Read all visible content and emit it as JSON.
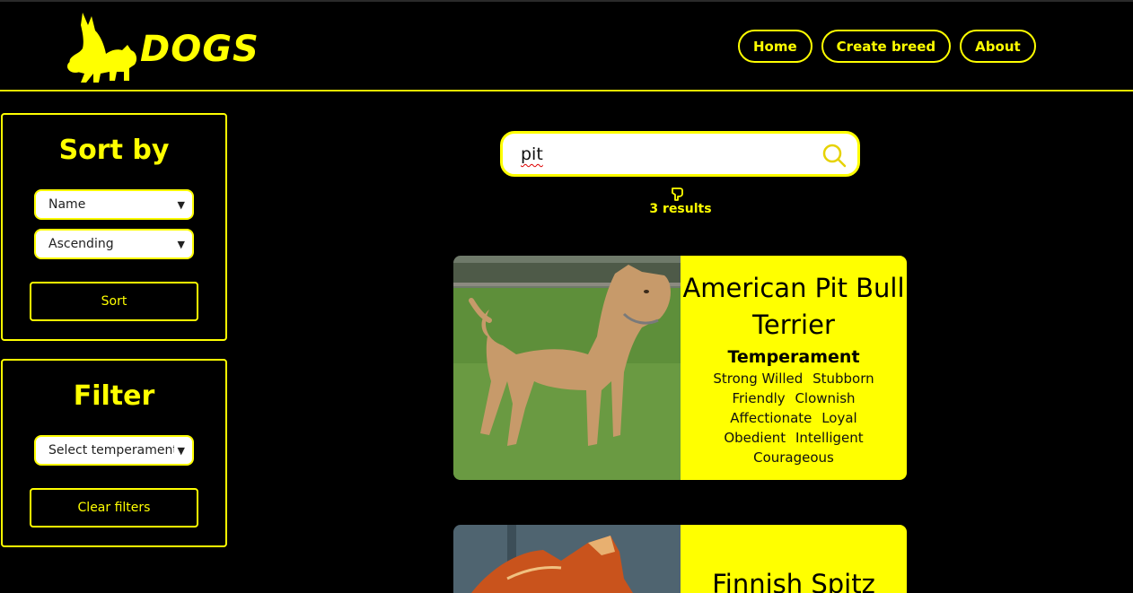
{
  "header": {
    "logo_text": "DOGS",
    "nav": [
      "Home",
      "Create breed",
      "About"
    ]
  },
  "sort_panel": {
    "title": "Sort by",
    "field_select": "Name",
    "order_select": "Ascending",
    "sort_button": "Sort"
  },
  "filter_panel": {
    "title": "Filter",
    "temperament_select": "Select temperament",
    "clear_button": "Clear filters"
  },
  "search": {
    "value": "pit",
    "results_label": "3 results"
  },
  "cards": [
    {
      "name": "American Pit Bull Terrier",
      "temperament_title": "Temperament",
      "temperaments": [
        "Strong Willed",
        "Stubborn",
        "Friendly",
        "Clownish",
        "Affectionate",
        "Loyal",
        "Obedient",
        "Intelligent",
        "Courageous"
      ]
    },
    {
      "name": "Finnish Spitz"
    }
  ],
  "colors": {
    "accent": "#ffff00",
    "background": "#000000",
    "card_info_bg": "#ffff00"
  },
  "icons": [
    "dog-silhouette-logo-icon",
    "search-icon",
    "pointing-hand-icon",
    "chevron-down-icon"
  ]
}
